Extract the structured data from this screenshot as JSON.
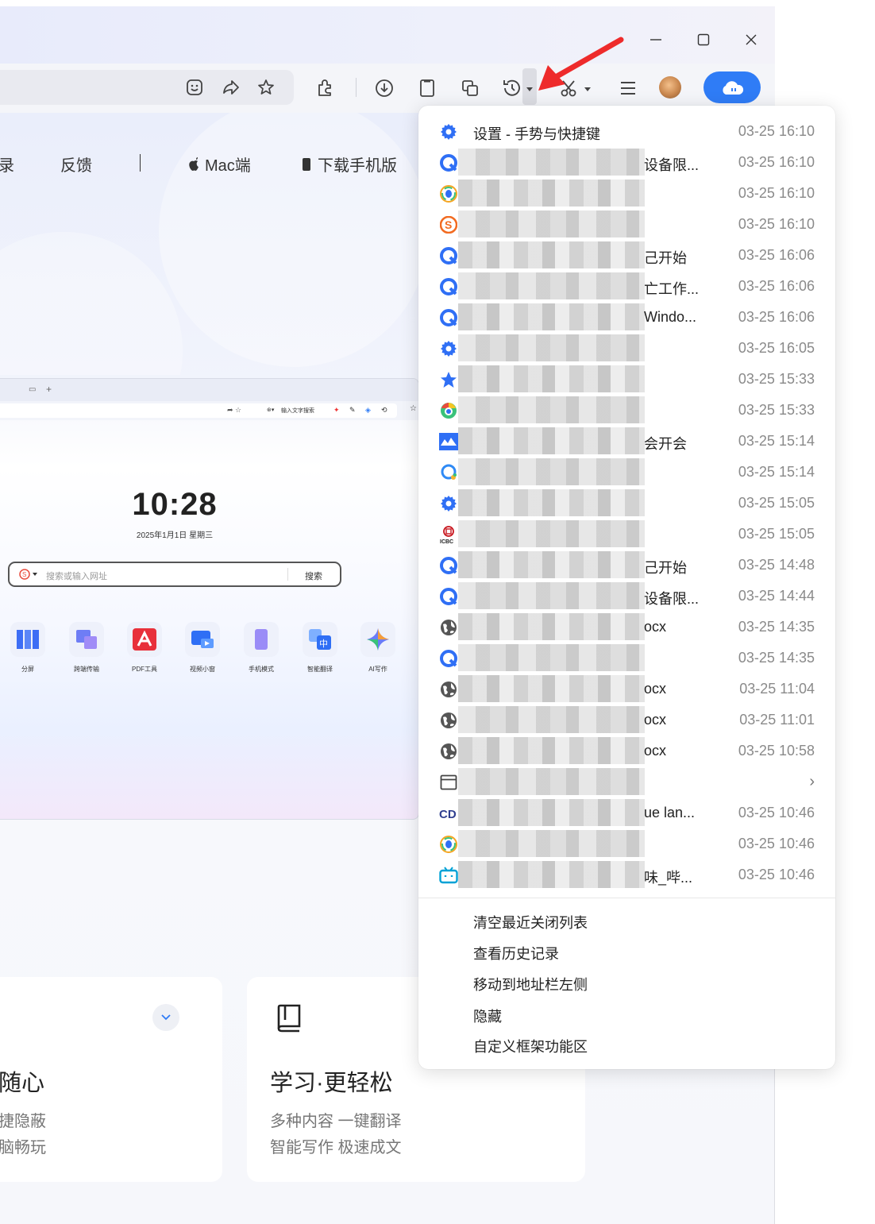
{
  "window": {
    "controls": {
      "minimize": "—",
      "maximize": "▢",
      "close": "✕"
    }
  },
  "toolbar": {
    "icons": [
      "emoji-icon",
      "share-icon",
      "star-add-icon",
      "extension-icon",
      "download-icon",
      "clipboard-icon",
      "screenshot-icon",
      "history-icon",
      "scissors-icon",
      "menu-icon"
    ],
    "accent": "#2f7cf6"
  },
  "nav": {
    "items": [
      "录",
      "反馈",
      "Mac端",
      "下载手机版"
    ]
  },
  "preview": {
    "clock": "10:28",
    "date": "2025年1月1日  星期三",
    "search_placeholder": "搜索或输入网址",
    "search_button": "搜索",
    "address_text": "输入文字搜索",
    "apps": [
      "分屏",
      "跨端传输",
      "PDF工具",
      "视频小窗",
      "手机模式",
      "智能翻译",
      "AI写作"
    ]
  },
  "cards": [
    {
      "title": "随心",
      "lines": [
        "捷隐蔽",
        "脑畅玩"
      ]
    },
    {
      "title": "学习·更轻松",
      "lines": [
        "多种内容 一键翻译",
        "智能写作 极速成文"
      ]
    }
  ],
  "menu": {
    "rows": [
      {
        "icon": "gear-icon",
        "title": "设置 - 手势与快捷键",
        "time": "03-25 16:10",
        "blurred": false
      },
      {
        "icon": "q-browser-icon",
        "title": "设备限...",
        "time": "03-25 16:10",
        "blurred": true
      },
      {
        "icon": "qq-icon",
        "title": "",
        "time": "03-25 16:10",
        "blurred": true
      },
      {
        "icon": "sogou-icon",
        "title": "",
        "time": "03-25 16:10",
        "blurred": true
      },
      {
        "icon": "q-browser-icon",
        "title": "己开始",
        "time": "03-25 16:06",
        "blurred": true
      },
      {
        "icon": "q-browser-icon",
        "title": "亡工作...",
        "time": "03-25 16:06",
        "blurred": true
      },
      {
        "icon": "q-browser-icon",
        "title": "Windo...",
        "time": "03-25 16:06",
        "blurred": true
      },
      {
        "icon": "gear-icon",
        "title": "",
        "time": "03-25 16:05",
        "blurred": true
      },
      {
        "icon": "star-icon",
        "title": "",
        "time": "03-25 15:33",
        "blurred": true
      },
      {
        "icon": "chrome-qq-icon",
        "title": "",
        "time": "03-25 15:33",
        "blurred": true
      },
      {
        "icon": "tencent-meeting-icon",
        "title": "会开会",
        "time": "03-25 15:14",
        "blurred": true
      },
      {
        "icon": "q-search-icon",
        "title": "",
        "time": "03-25 15:14",
        "blurred": true
      },
      {
        "icon": "gear-icon",
        "title": "",
        "time": "03-25 15:05",
        "blurred": true
      },
      {
        "icon": "icbc-icon",
        "title": "",
        "time": "03-25 15:05",
        "blurred": true
      },
      {
        "icon": "q-browser-icon",
        "title": "己开始",
        "time": "03-25 14:48",
        "blurred": true
      },
      {
        "icon": "q-browser-icon",
        "title": "设备限...",
        "time": "03-25 14:44",
        "blurred": true
      },
      {
        "icon": "globe-icon",
        "title": "ocx",
        "time": "03-25 14:35",
        "blurred": true
      },
      {
        "icon": "q-browser-icon",
        "title": "",
        "time": "03-25 14:35",
        "blurred": true
      },
      {
        "icon": "globe-icon",
        "title": "ocx",
        "time": "03-25 11:04",
        "blurred": true
      },
      {
        "icon": "globe-icon",
        "title": "ocx",
        "time": "03-25 11:01",
        "blurred": true
      },
      {
        "icon": "globe-icon",
        "title": "ocx",
        "time": "03-25 10:58",
        "blurred": true
      },
      {
        "icon": "window-icon",
        "title": "",
        "time": "",
        "blurred": true,
        "submenu": true
      },
      {
        "icon": "cd-icon",
        "title": "ue lan...",
        "time": "03-25 10:46",
        "blurred": true
      },
      {
        "icon": "qq-icon",
        "title": "",
        "time": "03-25 10:46",
        "blurred": true
      },
      {
        "icon": "bilibili-icon",
        "title": "味_哔...",
        "time": "03-25 10:46",
        "blurred": true
      }
    ],
    "actions": [
      "清空最近关闭列表",
      "查看历史记录",
      "移动到地址栏左侧",
      "隐藏",
      "自定义框架功能区"
    ]
  }
}
